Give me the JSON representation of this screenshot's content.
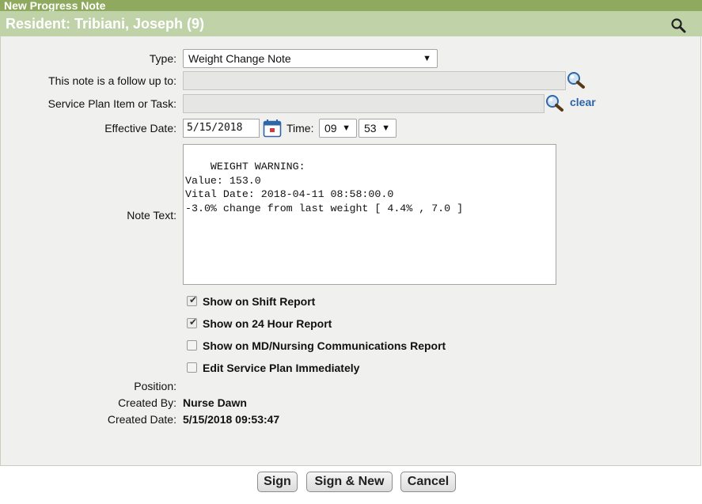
{
  "window": {
    "title": "New Progress Note"
  },
  "resident": {
    "label": "Resident:  Tribiani, Joseph (9)"
  },
  "form": {
    "type_label": "Type:",
    "type_value": "Weight Change Note",
    "followup_label": "This note is a follow up to:",
    "service_label": "Service Plan Item or Task:",
    "clear_label": "clear",
    "effective_date_label": "Effective Date:",
    "effective_date_value": "5/15/2018",
    "time_label": "Time:",
    "hour_value": "09",
    "minute_value": "53",
    "note_text_label": "Note Text:",
    "note_text_value": "WEIGHT WARNING:\nValue: 153.0\nVital Date: 2018-04-11 08:58:00.0\n-3.0% change from last weight [ 4.4% , 7.0 ]",
    "checkboxes": [
      {
        "label": "Show on Shift Report",
        "checked": true
      },
      {
        "label": "Show on 24 Hour Report",
        "checked": true
      },
      {
        "label": "Show on MD/Nursing Communications Report",
        "checked": false
      },
      {
        "label": "Edit Service Plan Immediately",
        "checked": false
      }
    ],
    "position_label": "Position:",
    "position_value": "",
    "created_by_label": "Created By:",
    "created_by_value": "Nurse Dawn",
    "created_date_label": "Created Date:",
    "created_date_value": "5/15/2018 09:53:47"
  },
  "buttons": {
    "sign": "Sign",
    "sign_new": "Sign & New",
    "cancel": "Cancel"
  },
  "colors": {
    "title_bar": "#8faa5e",
    "resident_bar": "#bfd2a8",
    "panel_bg": "#f0f0ee",
    "link": "#2a64ad"
  },
  "icons": {
    "header_search": "magnifier-icon",
    "field_lookup": "magnifier-icon",
    "date_picker": "calendar-icon"
  }
}
